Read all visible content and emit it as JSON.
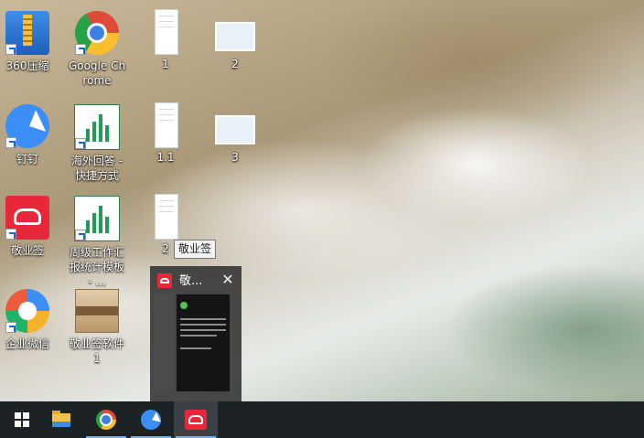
{
  "desktop": {
    "icons": [
      {
        "label": "360压缩",
        "icon": "archive-icon"
      },
      {
        "label": "Google Chrome",
        "icon": "chrome-icon"
      },
      {
        "label": "1",
        "icon": "document-icon"
      },
      {
        "label": "2",
        "icon": "screenshot-icon"
      },
      {
        "label": "钉钉",
        "icon": "dingtalk-icon"
      },
      {
        "label": "海外回答 - 快捷方式",
        "icon": "excel-icon"
      },
      {
        "label": "1.1",
        "icon": "document-icon"
      },
      {
        "label": "3",
        "icon": "screenshot-icon"
      },
      {
        "label": "敬业签",
        "icon": "jingyeqian-icon"
      },
      {
        "label": "周级工作汇报统计模板 - ...",
        "icon": "excel-icon"
      },
      {
        "label": "2",
        "icon": "document-icon"
      },
      {
        "label": "企业微信",
        "icon": "wework-icon"
      },
      {
        "label": "敬业签软件1",
        "icon": "package-icon"
      }
    ]
  },
  "tooltip": {
    "text": "敬业签"
  },
  "preview": {
    "title": "敬...",
    "close": "✕"
  },
  "taskbar": {
    "items": [
      {
        "name": "start",
        "icon": "windows-icon"
      },
      {
        "name": "file-explorer",
        "icon": "folder-icon"
      },
      {
        "name": "chrome",
        "icon": "chrome-icon"
      },
      {
        "name": "dingtalk",
        "icon": "dingtalk-icon"
      },
      {
        "name": "jingyeqian",
        "icon": "jingyeqian-icon",
        "active": true
      }
    ]
  },
  "colors": {
    "taskbar": "#1d2225",
    "active_item": "#3b4046",
    "accent": "#6fb1ec",
    "brand_red": "#e8283a"
  }
}
